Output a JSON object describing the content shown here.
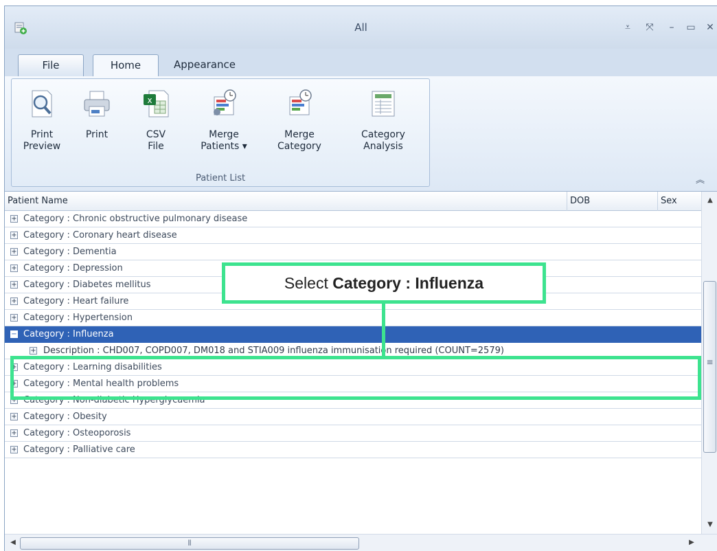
{
  "window": {
    "title": "All"
  },
  "tabs": {
    "file": "File",
    "home": "Home",
    "appearance": "Appearance"
  },
  "ribbon": {
    "print_preview": {
      "line1": "Print",
      "line2": "Preview"
    },
    "print": {
      "line1": "Print",
      "line2": ""
    },
    "csv_file": {
      "line1": "CSV",
      "line2": "File"
    },
    "merge_patients": {
      "line1": "Merge",
      "line2": "Patients ▾"
    },
    "merge_category": {
      "line1": "Merge",
      "line2": "Category"
    },
    "category_analysis": {
      "line1": "Category",
      "line2": "Analysis"
    },
    "group_label": "Patient List"
  },
  "grid": {
    "columns": {
      "name": "Patient Name",
      "dob": "DOB",
      "sex": "Sex"
    },
    "rows": [
      "Category : Chronic obstructive pulmonary disease",
      "Category : Coronary heart disease",
      "Category : Dementia",
      "Category : Depression",
      "Category : Diabetes mellitus",
      "Category : Heart failure",
      "Category : Hypertension",
      "Category : Influenza",
      "Description : CHD007, COPD007, DM018 and STIA009 influenza immunisation required (COUNT=2579)",
      "Category : Learning disabilities",
      "Category : Mental health problems",
      "Category : Non-diabetic Hyperglycaemia",
      "Category : Obesity",
      "Category : Osteoporosis",
      "Category : Palliative care"
    ]
  },
  "callout": {
    "prefix": "Select ",
    "bold": "Category : Influenza"
  },
  "colors": {
    "accent_highlight": "#3de38f",
    "selection": "#2f62b6"
  },
  "icons": [
    "print-preview-icon",
    "printer-icon",
    "csv-file-icon",
    "merge-patients-icon",
    "merge-category-icon",
    "category-analysis-icon"
  ]
}
